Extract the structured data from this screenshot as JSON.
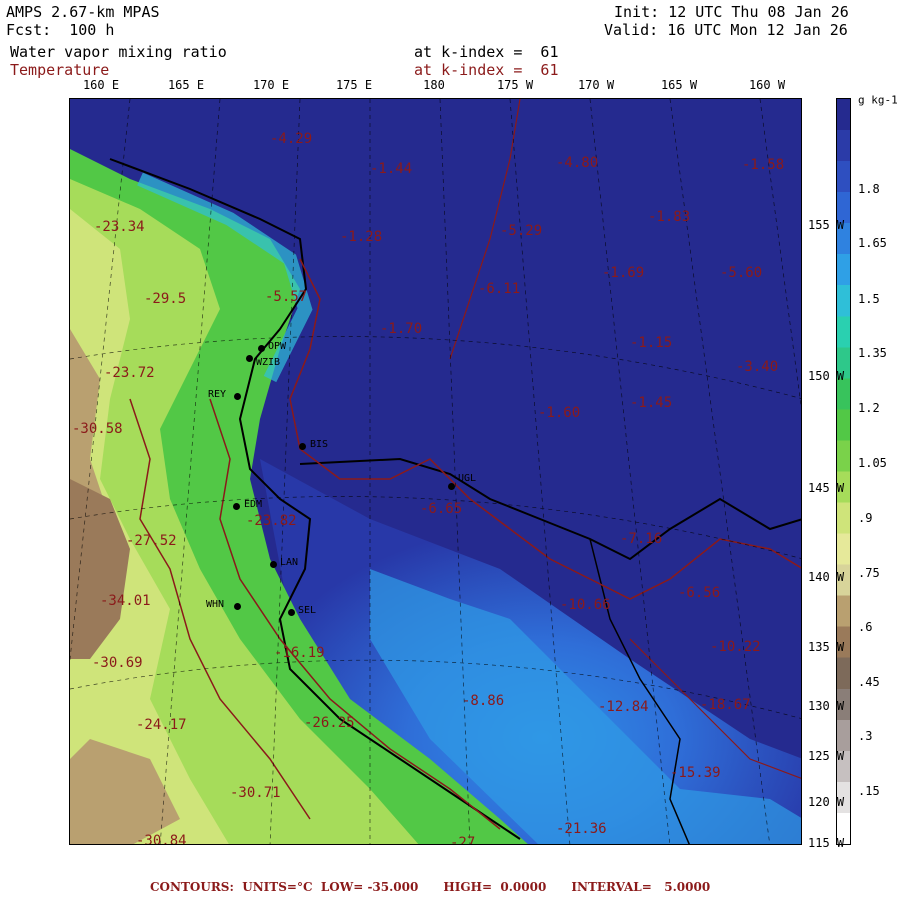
{
  "header": {
    "model": "AMPS 2.67-km MPAS",
    "fcst": "Fcst:  100 h",
    "field1": "Water vapor mixing ratio",
    "field2": "Temperature",
    "init": "Init: 12 UTC Thu 08 Jan 26",
    "valid": "Valid: 16 UTC Mon 12 Jan 26",
    "kindex1": "at k-index =  61",
    "kindex2": "at k-index =  61"
  },
  "longitudes": [
    "160 E",
    "165 E",
    "170 E",
    "175 E",
    "180",
    "175 W",
    "170 W",
    "165 W",
    "160 W"
  ],
  "latitudes": [
    "155 W",
    "150 W",
    "145 W",
    "140 W",
    "135 W",
    "130 W",
    "125 W",
    "120 W",
    "115 W"
  ],
  "colorbar": {
    "unit": "g kg-1",
    "labels": [
      "1.8",
      "1.65",
      "1.5",
      "1.35",
      "1.2",
      "1.05",
      ".9",
      ".75",
      ".6",
      ".45",
      ".3",
      ".15"
    ],
    "colors": [
      "#252a8f",
      "#2b3ba8",
      "#2e4fc0",
      "#2f66d4",
      "#2f82e0",
      "#2fa0e6",
      "#2fbfd8",
      "#2ad0b0",
      "#2ec88a",
      "#38c35c",
      "#52c846",
      "#7ad24a",
      "#a6dc5a",
      "#cfe47a",
      "#e6e99a",
      "#d8d49a",
      "#b9a070",
      "#9a7a5a",
      "#7d6a5a",
      "#8a7e78",
      "#a89e9c",
      "#c6c0c0",
      "#e4e2e2",
      "#ffffff"
    ]
  },
  "map_labels": [
    "-4.29",
    "-5.57",
    "-1.44",
    "-4.80",
    "-1.58",
    "-1.28",
    "-5.29",
    "-1.83",
    "-1.69",
    "-5.60",
    "-6.11",
    "-1.70",
    "-1.15",
    "-3.40",
    "-1.60",
    "-1.45",
    "-6.65",
    "-7.16",
    "-10.66",
    "-6.56",
    "-10.22",
    "-8.86",
    "-12.84",
    "-18.67",
    "-15.39",
    "-23.34",
    "-29.5",
    "-23.72",
    "-30.58",
    "-27.52",
    "-34.01",
    "-30.69",
    "-24.17",
    "-30.71",
    "-30.84",
    "-26.25",
    "-23.82",
    "-16.19",
    "-27",
    "-21.36"
  ],
  "stations": [
    "OPW",
    "WZIB",
    "REY",
    "BIS",
    "UGL",
    "EDM",
    "LAN",
    "SEL",
    "WHN"
  ],
  "footer": "CONTOURS:  UNITS=°C  LOW= -35.000      HIGH=  0.0000      INTERVAL=   5.0000"
}
